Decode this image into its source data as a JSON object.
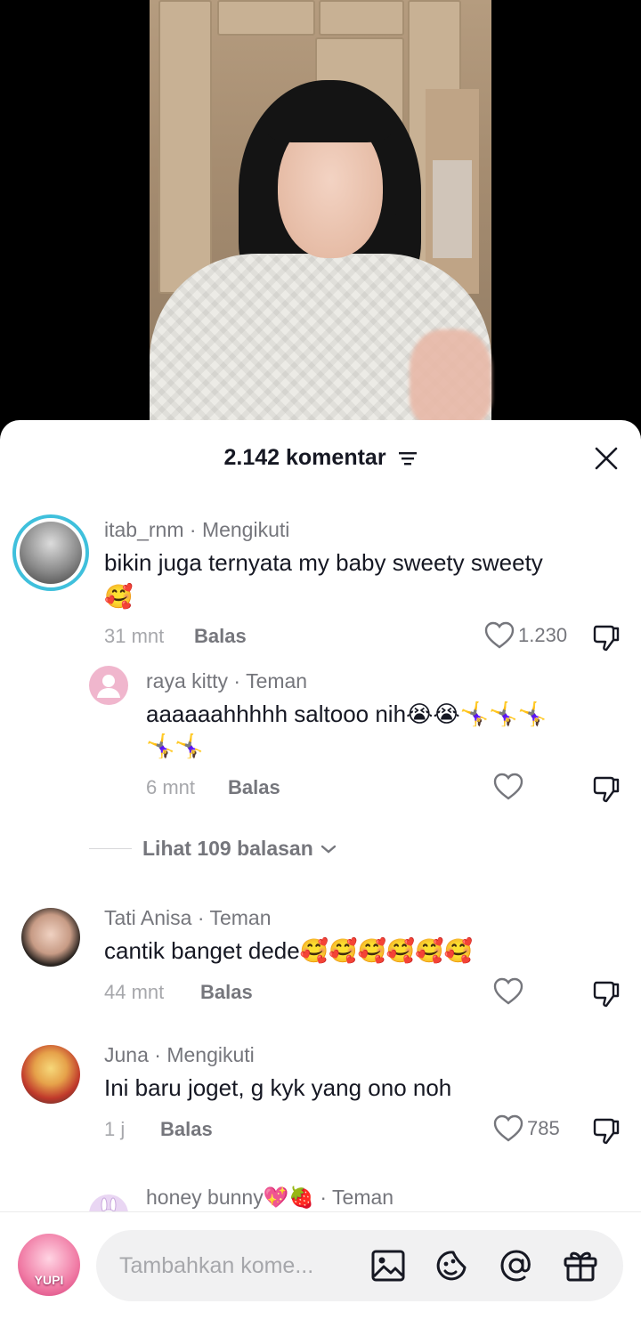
{
  "header": {
    "comment_count_label": "2.142 komentar"
  },
  "comments": [
    {
      "username": "itab_rnm",
      "relation": "Mengikuti",
      "text": "bikin juga ternyata my baby sweety sweety",
      "emoji": "🥰",
      "time": "31 mnt",
      "reply_label": "Balas",
      "likes": "1.230"
    },
    {
      "username": "raya kitty",
      "relation": "Teman",
      "text": "aaaaaahhhhh saltooo nih😭😭🤸‍♀️🤸‍♀️🤸‍♀️",
      "text2": "🤸‍♀️🤸‍♀️",
      "time": "6 mnt",
      "reply_label": "Balas",
      "likes": ""
    },
    {
      "username": "Tati Anisa",
      "relation": "Teman",
      "text": "cantik banget dede🥰🥰🥰🥰🥰🥰",
      "time": "44 mnt",
      "reply_label": "Balas",
      "likes": ""
    },
    {
      "username": "Juna",
      "relation": "Mengikuti",
      "text": "Ini baru joget, g kyk yang ono noh",
      "time": "1 j",
      "reply_label": "Balas",
      "likes": "785"
    },
    {
      "username": "honey bunny💖🍓",
      "relation": "Teman"
    }
  ],
  "replies_toggle": {
    "label": "Lihat 109 balasan"
  },
  "composer": {
    "placeholder": "Tambahkan kome...",
    "avatar_text": "YUPI"
  },
  "icons": {
    "sort": "sort-icon",
    "close": "close-icon",
    "heart": "heart-icon",
    "dislike": "dislike-icon",
    "image": "image-icon",
    "emoji": "emoji-icon",
    "mention": "mention-icon",
    "gift": "gift-icon"
  },
  "colors": {
    "story_ring": "#3fc0dc",
    "text_primary": "#161823",
    "text_secondary": "#75767c",
    "text_muted": "#a6a7ab"
  }
}
